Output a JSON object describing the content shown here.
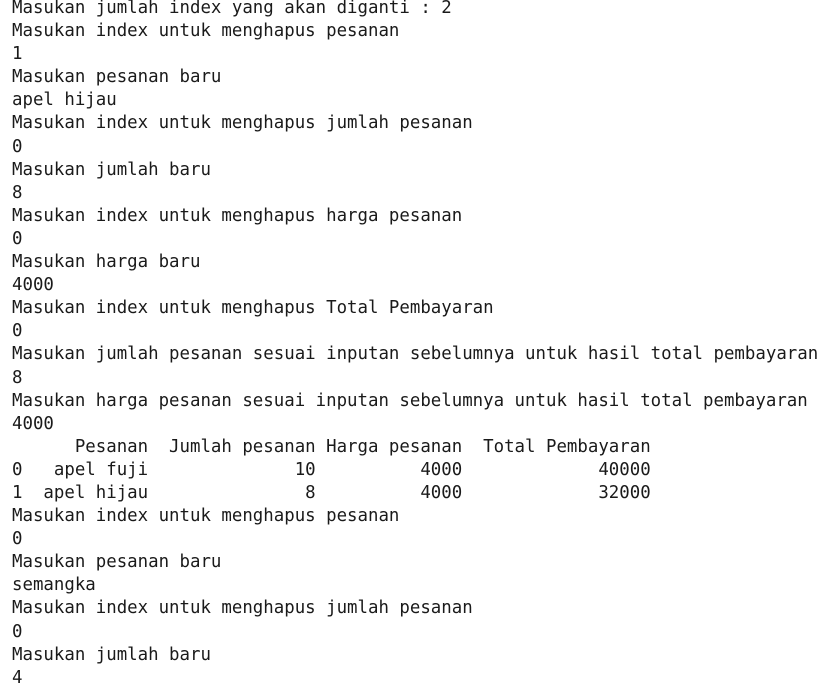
{
  "console": {
    "lines": [
      "Masukan jumlah index yang akan diganti : 2",
      "Masukan index untuk menghapus pesanan",
      "1",
      "Masukan pesanan baru",
      "apel hijau",
      "Masukan index untuk menghapus jumlah pesanan",
      "0",
      "Masukan jumlah baru",
      "8",
      "Masukan index untuk menghapus harga pesanan",
      "0",
      "Masukan harga baru",
      "4000",
      "Masukan index untuk menghapus Total Pembayaran",
      "0",
      "Masukan jumlah pesanan sesuai inputan sebelumnya untuk hasil total pembayaran",
      "8",
      "Masukan harga pesanan sesuai inputan sebelumnya untuk hasil total pembayaran",
      "4000",
      "      Pesanan  Jumlah pesanan Harga pesanan  Total Pembayaran",
      "0   apel fuji              10          4000             40000",
      "1  apel hijau               8          4000             32000",
      "Masukan index untuk menghapus pesanan",
      "0",
      "Masukan pesanan baru",
      "semangka",
      "Masukan index untuk menghapus jumlah pesanan",
      "0",
      "Masukan jumlah baru",
      "4"
    ]
  }
}
